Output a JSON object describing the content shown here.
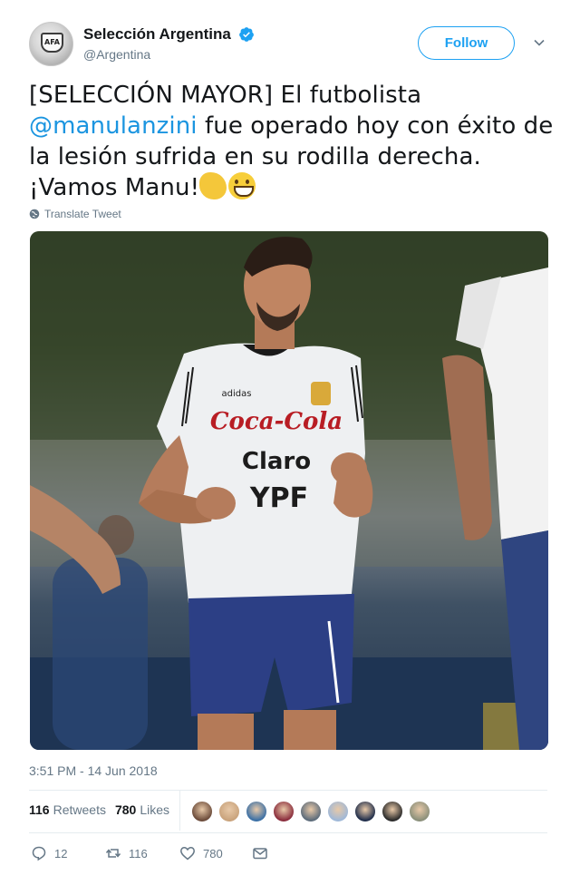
{
  "account": {
    "display_name": "Selección Argentina",
    "handle": "@Argentina",
    "verified": true,
    "avatar_icon": "afa-crest-avatar"
  },
  "follow_button": {
    "label": "Follow"
  },
  "tweet": {
    "text_before": "[SELECCIÓN MAYOR] El futbolista ",
    "mention": "@manulanzini",
    "text_after": " fue operado hoy con éxito de la lesión sufrida en su rodilla derecha. ¡Vamos Manu!",
    "emojis": [
      "flexed-biceps-emoji",
      "grinning-face-emoji"
    ],
    "translate_label": "Translate Tweet",
    "photo": {
      "jersey_sponsors": [
        "Coca-Cola",
        "Claro",
        "YPF"
      ],
      "jersey_brand": "adidas",
      "crest_text": "AFA"
    },
    "timestamp": "3:51 PM - 14 Jun 2018"
  },
  "stats": {
    "retweets_count": "116",
    "retweets_label": "Retweets",
    "likes_count": "780",
    "likes_label": "Likes"
  },
  "likers": [
    "#6b4b3a",
    "#c9a37c",
    "#3a6fa5",
    "#8a2c3c",
    "#5c6b7a",
    "#9fb8d8",
    "#1f2d4a",
    "#2a2a2a",
    "#8a8f7a"
  ],
  "actions": {
    "reply_count": "12",
    "retweet_count": "116",
    "like_count": "780"
  },
  "colors": {
    "accent": "#1da1f2",
    "mention": "#1b95e0",
    "secondary_text": "#657786",
    "divider": "#e6ecf0"
  }
}
